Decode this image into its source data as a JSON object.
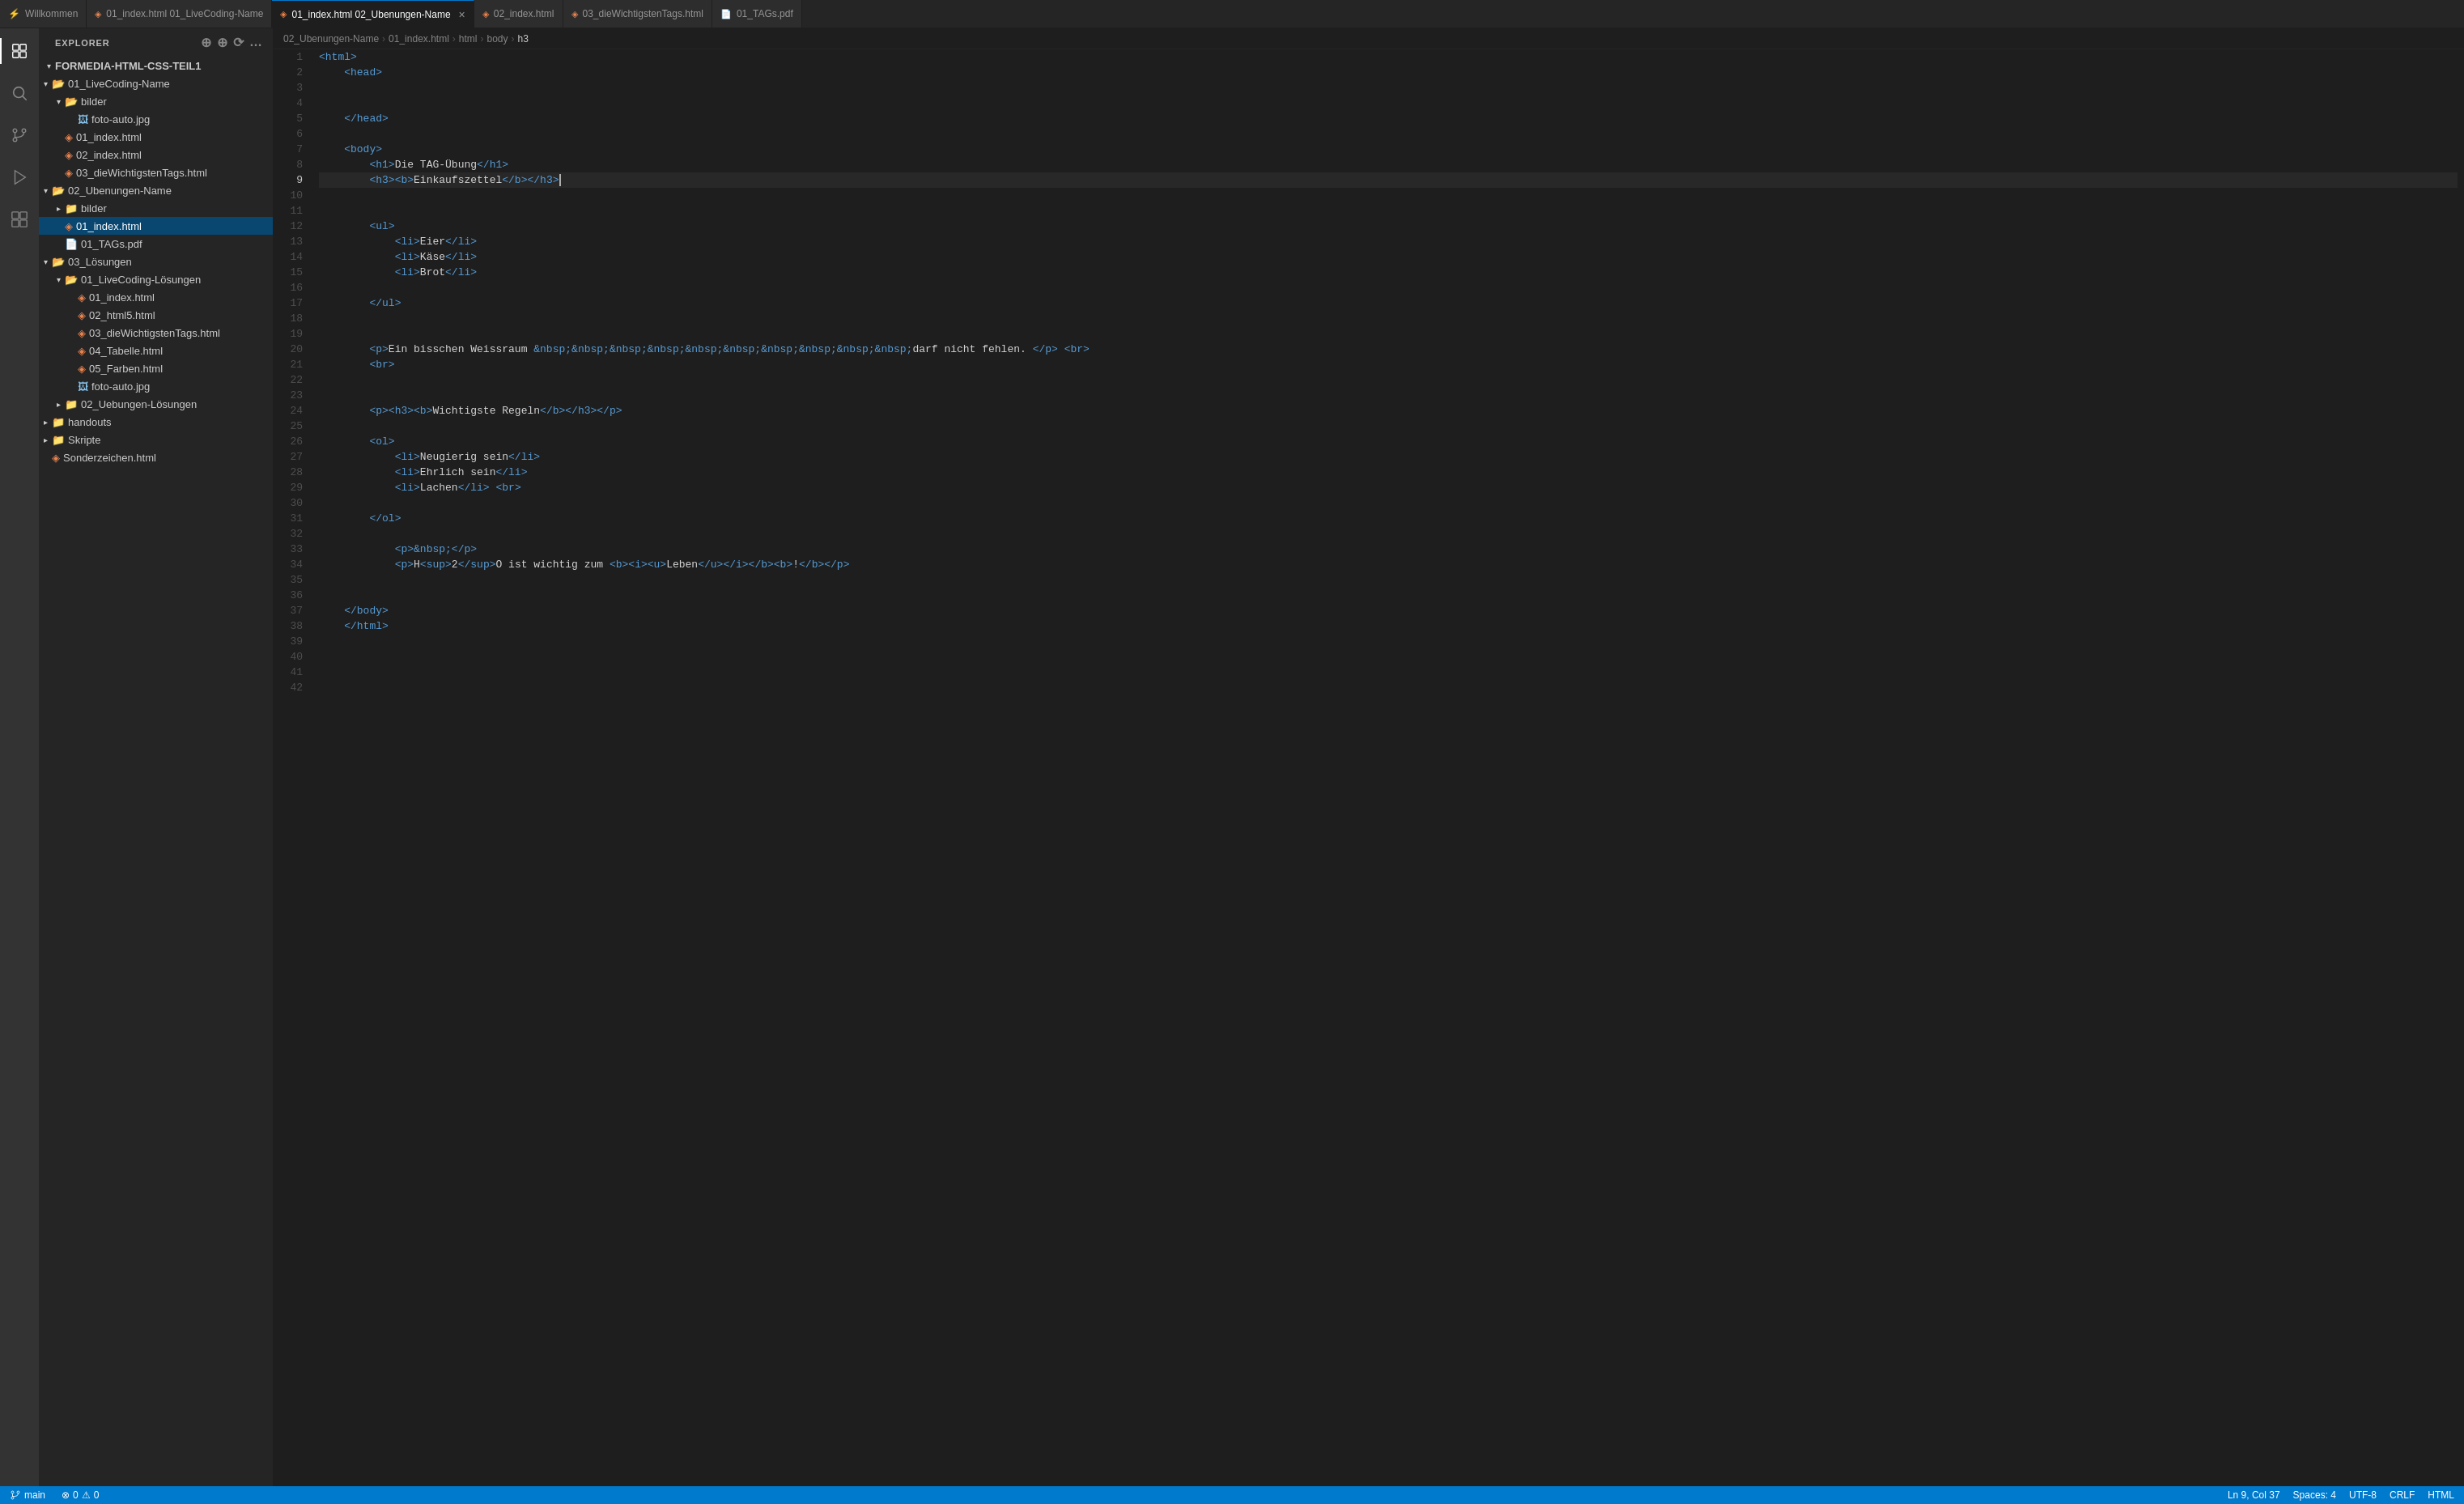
{
  "activityBar": {
    "icons": [
      {
        "name": "explorer-icon",
        "glyph": "⧉",
        "active": true
      },
      {
        "name": "search-icon",
        "glyph": "🔍",
        "active": false
      },
      {
        "name": "source-control-icon",
        "glyph": "⑂",
        "active": false
      },
      {
        "name": "run-icon",
        "glyph": "▷",
        "active": false
      },
      {
        "name": "extensions-icon",
        "glyph": "⊞",
        "active": false
      }
    ]
  },
  "sidebar": {
    "title": "EXPLORER",
    "rootFolder": "FORMEDIA-HTML-CSS-TEIL1",
    "tree": [
      {
        "id": 1,
        "label": "01_LiveCoding-Name",
        "type": "folder",
        "depth": 1,
        "expanded": true
      },
      {
        "id": 2,
        "label": "bilder",
        "type": "folder",
        "depth": 2,
        "expanded": true
      },
      {
        "id": 3,
        "label": "foto-auto.jpg",
        "type": "jpg",
        "depth": 3
      },
      {
        "id": 4,
        "label": "01_index.html",
        "type": "html",
        "depth": 2
      },
      {
        "id": 5,
        "label": "02_index.html",
        "type": "html",
        "depth": 2
      },
      {
        "id": 6,
        "label": "03_dieWichtigstenTags.html",
        "type": "html",
        "depth": 2
      },
      {
        "id": 7,
        "label": "02_Ubenungen-Name",
        "type": "folder",
        "depth": 1,
        "expanded": true
      },
      {
        "id": 8,
        "label": "bilder",
        "type": "folder",
        "depth": 2,
        "expanded": false
      },
      {
        "id": 9,
        "label": "01_index.html",
        "type": "html",
        "depth": 2,
        "selected": true
      },
      {
        "id": 10,
        "label": "01_TAGs.pdf",
        "type": "pdf",
        "depth": 2
      },
      {
        "id": 11,
        "label": "03_Lösungen",
        "type": "folder",
        "depth": 1,
        "expanded": true
      },
      {
        "id": 12,
        "label": "01_LiveCoding-Lösungen",
        "type": "folder",
        "depth": 2,
        "expanded": true
      },
      {
        "id": 13,
        "label": "01_index.html",
        "type": "html",
        "depth": 3
      },
      {
        "id": 14,
        "label": "02_html5.html",
        "type": "html",
        "depth": 3
      },
      {
        "id": 15,
        "label": "03_dieWichtigstenTags.html",
        "type": "html",
        "depth": 3
      },
      {
        "id": 16,
        "label": "04_Tabelle.html",
        "type": "html",
        "depth": 3
      },
      {
        "id": 17,
        "label": "05_Farben.html",
        "type": "html",
        "depth": 3
      },
      {
        "id": 18,
        "label": "foto-auto.jpg",
        "type": "jpg",
        "depth": 3
      },
      {
        "id": 19,
        "label": "02_Uebungen-Lösungen",
        "type": "folder",
        "depth": 2,
        "expanded": false
      },
      {
        "id": 20,
        "label": "handouts",
        "type": "folder",
        "depth": 1,
        "expanded": false
      },
      {
        "id": 21,
        "label": "Skripte",
        "type": "folder",
        "depth": 1,
        "expanded": false
      },
      {
        "id": 22,
        "label": "Sonderzeichen.html",
        "type": "html",
        "depth": 1
      }
    ]
  },
  "tabs": [
    {
      "id": 1,
      "label": "Willkommen",
      "type": "welcome",
      "active": false,
      "closable": false
    },
    {
      "id": 2,
      "label": "01_index.html",
      "sublabel": "01_LiveCoding-Name",
      "type": "html",
      "active": false,
      "closable": false,
      "modified": false
    },
    {
      "id": 3,
      "label": "01_index.html",
      "sublabel": "02_Ubenungen-Name",
      "type": "html",
      "active": true,
      "closable": true,
      "modified": false
    },
    {
      "id": 4,
      "label": "02_index.html",
      "type": "html",
      "active": false,
      "closable": false
    },
    {
      "id": 5,
      "label": "03_dieWichtigstenTags.html",
      "type": "html",
      "active": false,
      "closable": false
    },
    {
      "id": 6,
      "label": "01_TAGs.pdf",
      "type": "pdf",
      "active": false,
      "closable": false
    }
  ],
  "breadcrumb": {
    "items": [
      "02_Ubenungen-Name",
      "01_index.html",
      "html",
      "body",
      "h3"
    ]
  },
  "editor": {
    "activeLine": 9,
    "lines": [
      {
        "num": 1,
        "content": "<html>"
      },
      {
        "num": 2,
        "content": "    <head>"
      },
      {
        "num": 3,
        "content": ""
      },
      {
        "num": 4,
        "content": ""
      },
      {
        "num": 5,
        "content": "    </head>"
      },
      {
        "num": 6,
        "content": ""
      },
      {
        "num": 7,
        "content": "    <body>"
      },
      {
        "num": 8,
        "content": "        <h1>Die TAG-Übung</h1>"
      },
      {
        "num": 9,
        "content": "        <h3><b>Einkaufszettel</b></h3>"
      },
      {
        "num": 10,
        "content": ""
      },
      {
        "num": 11,
        "content": ""
      },
      {
        "num": 12,
        "content": "        <ul>"
      },
      {
        "num": 13,
        "content": "            <li>Eier</li>"
      },
      {
        "num": 14,
        "content": "            <li>Käse</li>"
      },
      {
        "num": 15,
        "content": "            <li>Brot</li>"
      },
      {
        "num": 16,
        "content": ""
      },
      {
        "num": 17,
        "content": "        </ul>"
      },
      {
        "num": 18,
        "content": ""
      },
      {
        "num": 19,
        "content": ""
      },
      {
        "num": 20,
        "content": "        <p>Ein bisschen Weissraum &nbsp;&nbsp;&nbsp;&nbsp;&nbsp;&nbsp;&nbsp;&nbsp;&nbsp;&nbsp;darf nicht fehlen. </p> <br>"
      },
      {
        "num": 21,
        "content": "        <br>"
      },
      {
        "num": 22,
        "content": ""
      },
      {
        "num": 23,
        "content": ""
      },
      {
        "num": 24,
        "content": "        <p><h3><b>Wichtigste Regeln</b></h3></p>"
      },
      {
        "num": 25,
        "content": ""
      },
      {
        "num": 26,
        "content": "        <ol>"
      },
      {
        "num": 27,
        "content": "            <li>Neugierig sein</li>"
      },
      {
        "num": 28,
        "content": "            <li>Ehrlich sein</li>"
      },
      {
        "num": 29,
        "content": "            <li>Lachen</li> <br>"
      },
      {
        "num": 30,
        "content": ""
      },
      {
        "num": 31,
        "content": "        </ol>"
      },
      {
        "num": 32,
        "content": ""
      },
      {
        "num": 33,
        "content": "            <p>&nbsp;</p>"
      },
      {
        "num": 34,
        "content": "            <p>H<sup>2</sup>O ist wichtig zum <b><i><u>Leben</u></i></b><b>!</b></p>"
      },
      {
        "num": 35,
        "content": ""
      },
      {
        "num": 36,
        "content": ""
      },
      {
        "num": 37,
        "content": "    </body>"
      },
      {
        "num": 38,
        "content": "    </html>"
      },
      {
        "num": 39,
        "content": ""
      },
      {
        "num": 40,
        "content": ""
      },
      {
        "num": 41,
        "content": ""
      },
      {
        "num": 42,
        "content": ""
      }
    ]
  },
  "statusBar": {
    "branch": "main",
    "errors": "0",
    "warnings": "0",
    "cursorPosition": "Ln 9, Col 37",
    "encoding": "UTF-8",
    "lineEnding": "CRLF",
    "language": "HTML",
    "spaces": "Spaces: 4"
  }
}
